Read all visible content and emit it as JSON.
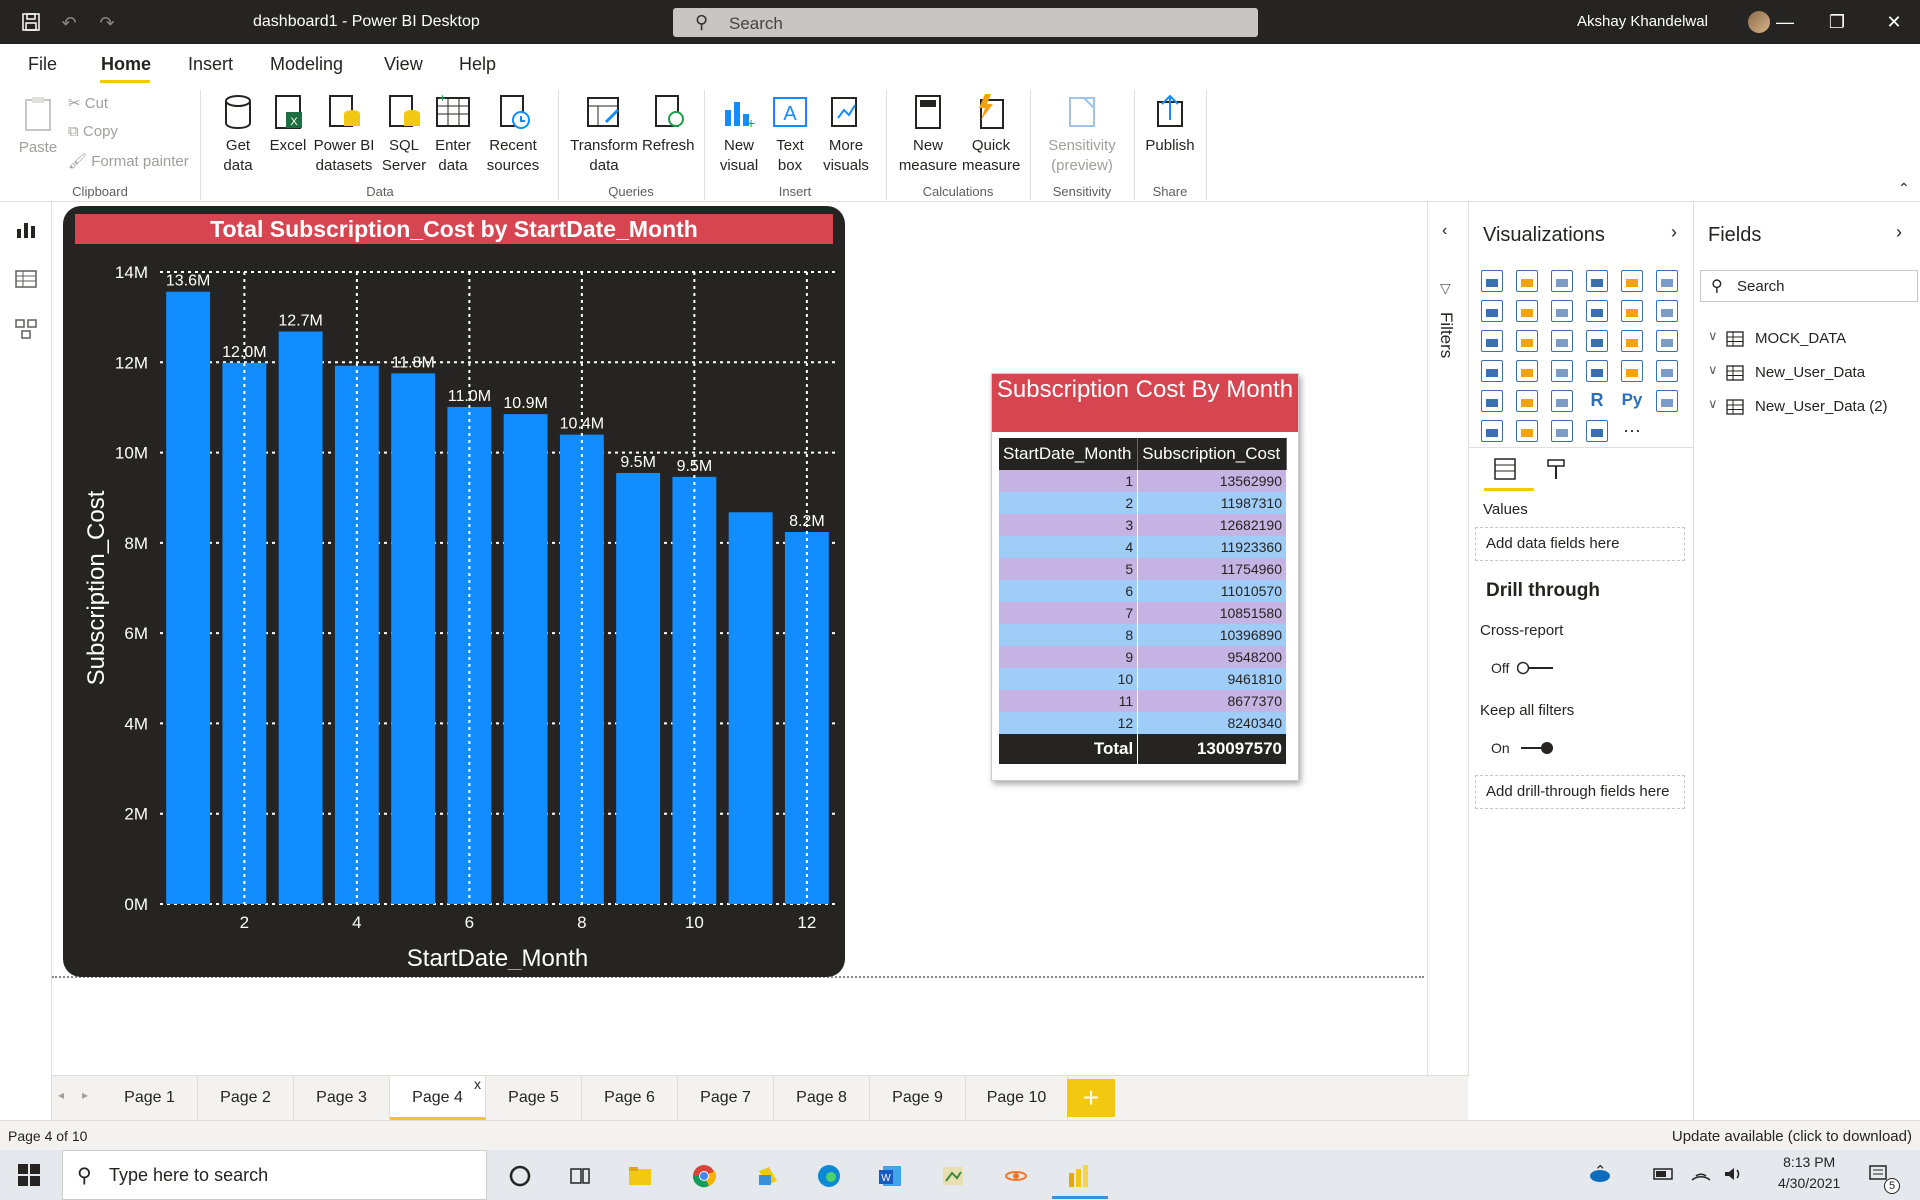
{
  "titlebar": {
    "title": "dashboard1 - Power BI Desktop",
    "search_placeholder": "Search",
    "user": "Akshay Khandelwal"
  },
  "menu": {
    "tabs": [
      "File",
      "Home",
      "Insert",
      "Modeling",
      "View",
      "Help"
    ],
    "active": "Home"
  },
  "ribbon": {
    "clipboard": {
      "paste": "Paste",
      "cut": "Cut",
      "copy": "Copy",
      "format_painter": "Format painter",
      "group": "Clipboard"
    },
    "data": {
      "get_data": "Get data",
      "excel": "Excel",
      "pbi_datasets": "Power BI datasets",
      "sql": "SQL Server",
      "enter": "Enter data",
      "recent": "Recent sources",
      "group": "Data"
    },
    "queries": {
      "transform": "Transform data",
      "refresh": "Refresh",
      "group": "Queries"
    },
    "insert": {
      "new_visual": "New visual",
      "text_box": "Text box",
      "more_visuals": "More visuals",
      "group": "Insert"
    },
    "calculations": {
      "new_measure": "New measure",
      "quick_measure": "Quick measure",
      "group": "Calculations"
    },
    "sensitivity": {
      "label": "Sensitivity (preview)",
      "group": "Sensitivity"
    },
    "share": {
      "publish": "Publish",
      "group": "Share"
    }
  },
  "chart_data": {
    "type": "bar",
    "title": "Total Subscription_Cost by StartDate_Month",
    "xlabel": "StartDate_Month",
    "ylabel": "Subscription_Cost",
    "categories": [
      1,
      2,
      3,
      4,
      5,
      6,
      7,
      8,
      9,
      10,
      11,
      12
    ],
    "values": [
      13562990,
      11987310,
      12682190,
      11923360,
      11754960,
      11010570,
      10851580,
      10396890,
      9548200,
      9461810,
      8677370,
      8240340
    ],
    "data_labels": [
      "13.6M",
      "12.0M",
      "12.7M",
      "",
      "11.8M",
      "11.0M",
      "10.9M",
      "10.4M",
      "9.5M",
      "9.5M",
      "",
      "8.2M"
    ],
    "x_tick_labels": [
      "2",
      "4",
      "6",
      "8",
      "10",
      "12"
    ],
    "y_tick_labels": [
      "0M",
      "2M",
      "4M",
      "6M",
      "8M",
      "10M",
      "12M",
      "14M"
    ],
    "ylim": [
      0,
      14000000
    ],
    "bar_color": "#118dff",
    "background": "#252423",
    "title_color": "#d64550",
    "grid": true
  },
  "table": {
    "title": "Subscription Cost By Month",
    "headers": [
      "StartDate_Month",
      "Subscription_Cost"
    ],
    "rows": [
      [
        "1",
        "13562990"
      ],
      [
        "2",
        "11987310"
      ],
      [
        "3",
        "12682190"
      ],
      [
        "4",
        "11923360"
      ],
      [
        "5",
        "11754960"
      ],
      [
        "6",
        "11010570"
      ],
      [
        "7",
        "10851580"
      ],
      [
        "8",
        "10396890"
      ],
      [
        "9",
        "9548200"
      ],
      [
        "10",
        "9461810"
      ],
      [
        "11",
        "8677370"
      ],
      [
        "12",
        "8240340"
      ]
    ],
    "total_label": "Total",
    "total_value": "130097570"
  },
  "filters": {
    "label": "Filters"
  },
  "visualizations": {
    "title": "Visualizations",
    "values_label": "Values",
    "values_drop": "Add data fields here",
    "drill_through": "Drill through",
    "cross_report": "Cross-report",
    "cross_report_state": "Off",
    "keep_all_filters": "Keep all filters",
    "keep_all_state": "On",
    "drill_drop": "Add drill-through fields here",
    "r_label": "R",
    "py_label": "Py",
    "more_label": "···"
  },
  "fields": {
    "title": "Fields",
    "search_placeholder": "Search",
    "tables": [
      "MOCK_DATA",
      "New_User_Data",
      "New_User_Data (2)"
    ]
  },
  "pages": {
    "tabs": [
      "Page 1",
      "Page 2",
      "Page 3",
      "Page 4",
      "Page 5",
      "Page 6",
      "Page 7",
      "Page 8",
      "Page 9",
      "Page 10"
    ],
    "active": "Page 4",
    "close_mark": "x",
    "add": "+"
  },
  "status": {
    "left": "Page 4 of 10",
    "right": "Update available (click to download)"
  },
  "taskbar": {
    "search_placeholder": "Type here to search",
    "time": "8:13 PM",
    "date": "4/30/2021",
    "notifications": "5"
  }
}
